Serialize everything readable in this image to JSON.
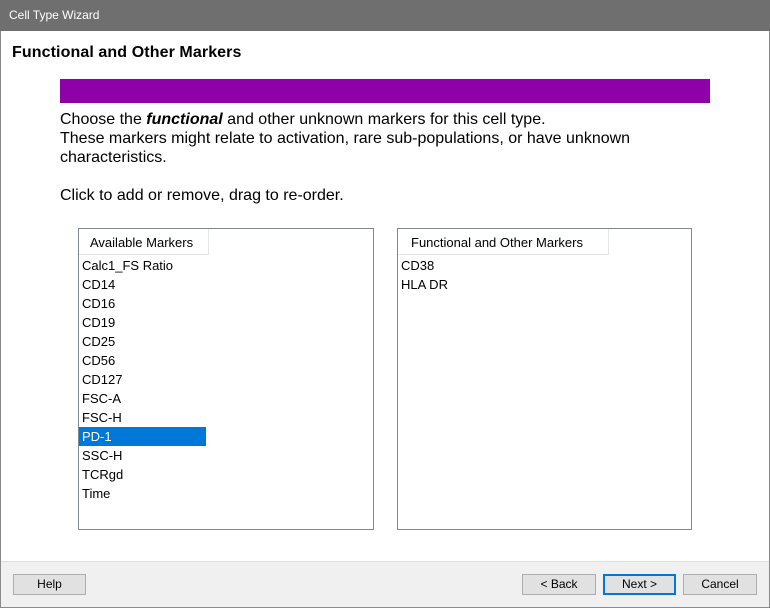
{
  "window": {
    "title": "Cell Type Wizard"
  },
  "page": {
    "title": "Functional and Other Markers",
    "accent_color": "#8e00a8",
    "description": {
      "prefix": "Choose the ",
      "emphasis": "functional",
      "suffix": " and other unknown markers for this cell type.",
      "line2": "These markers might relate to activation, rare sub-populations, or have unknown",
      "line3": "characteristics."
    },
    "hint": "Click to add or remove, drag to re-order."
  },
  "available_list": {
    "header": "Available Markers",
    "items": [
      "Calc1_FS Ratio",
      "CD14",
      "CD16",
      "CD19",
      "CD25",
      "CD56",
      "CD127",
      "FSC-A",
      "FSC-H",
      "PD-1",
      "SSC-H",
      "TCRgd",
      "Time"
    ],
    "selected_item": "PD-1",
    "selection_color": "#0078d7"
  },
  "selected_list": {
    "header": "Functional and Other Markers",
    "items": [
      "CD38",
      "HLA DR"
    ]
  },
  "buttons": {
    "help": "Help",
    "back": "< Back",
    "next": "Next >",
    "cancel": "Cancel"
  }
}
